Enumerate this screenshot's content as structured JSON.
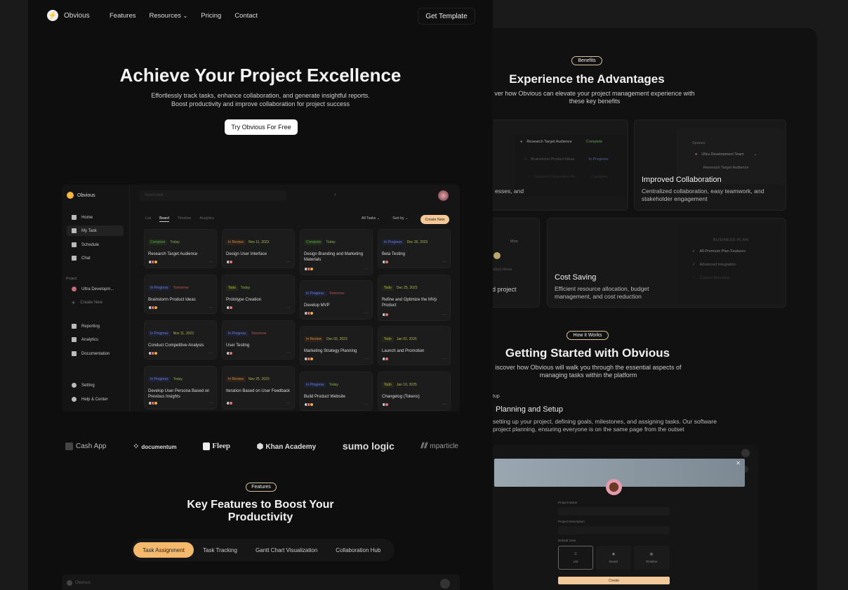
{
  "nav": {
    "brand": "Obvious",
    "links": [
      "Features",
      "Resources",
      "Pricing",
      "Contact"
    ],
    "cta": "Get Template"
  },
  "hero": {
    "title": "Achieve Your Project Excellence",
    "subtitle": "Effortlessly track tasks, enhance collaboration, and generate insightful reports. Boost productivity and improve collaboration for project success",
    "cta": "Try Obvious For Free"
  },
  "app": {
    "brand": "Obvious",
    "search_placeholder": "Search task",
    "search_shortcut": "/",
    "sidebar": {
      "main": [
        "Home",
        "My Task",
        "Schedule",
        "Chat"
      ],
      "section": "Project",
      "project": "Ultra Developm...",
      "create": "Create New",
      "tools": [
        "Reporting",
        "Analytics",
        "Documentation"
      ],
      "bottom": [
        "Setting",
        "Help & Center"
      ]
    },
    "tabs": [
      "List",
      "Board",
      "Timeline",
      "Analytics"
    ],
    "active_tab": "Board",
    "filter": "All Tasks",
    "sort": "Sort by",
    "create_new": "Create New",
    "cards": [
      {
        "status": "Complete",
        "date": "Today",
        "title": "Research Target Audience"
      },
      {
        "status": "In Review",
        "date": "Nov 11, 2023",
        "title": "Design User Interface"
      },
      {
        "status": "Complete",
        "date": "Today",
        "title": "Design Branding and Marketing Materials"
      },
      {
        "status": "In Progress",
        "date": "Dec 20, 2023",
        "title": "Beta Testing"
      },
      {
        "status": "In Progress",
        "date": "Tomorrow",
        "title": "Brainstorm Product Ideas"
      },
      {
        "status": "Todo",
        "date": "Today",
        "title": "Prototype Creation"
      },
      {
        "status": "In Progress",
        "date": "Tomorrow",
        "title": "Develop MVP"
      },
      {
        "status": "Todo",
        "date": "Dec 25, 2023",
        "title": "Refine and Optimize the MVp Product"
      },
      {
        "status": "In Progress",
        "date": "Nov 11, 2023",
        "title": "Conduct Competitive Analysis"
      },
      {
        "status": "In Progress",
        "date": "Tomorrow",
        "title": "User Testing"
      },
      {
        "status": "In Review",
        "date": "Dec 02, 2023",
        "title": "Marketing Strategy Planning"
      },
      {
        "status": "Todo",
        "date": "Jan 02, 2025",
        "title": "Launch and Promotion"
      },
      {
        "status": "In Progress",
        "date": "Today",
        "title": "Develop User Persona Based on Previous Insights"
      },
      {
        "status": "In Review",
        "date": "Nov 25, 2023",
        "title": "Iteration Based on User Feedback"
      },
      {
        "status": "In Progress",
        "date": "Today",
        "title": "Build Product Website"
      },
      {
        "status": "Todo",
        "date": "Jan 10, 2025",
        "title": "Changelog (Tokens)"
      }
    ]
  },
  "logos": [
    "Cash App",
    "documentum",
    "Fleep",
    "Khan Academy",
    "sumo logic",
    "mparticle"
  ],
  "features": {
    "badge": "Features",
    "title_line1": "Key Features to Boost Your",
    "title_line2": "Productivity",
    "tabs": [
      "Task Assignment",
      "Task Tracking",
      "Gantt Chart Visualization",
      "Collaboration Hub"
    ],
    "active_tab": "Task Assignment",
    "preview_brand": "Obvious"
  },
  "benefits": {
    "badge": "Benefits",
    "title": "Experience the Advantages",
    "subtitle_line1": "ver how Obvious can elevate your project management experience with",
    "subtitle_line2": "these key benefits",
    "card1": {
      "desc_fragment": "esses, and",
      "rows": [
        {
          "task": "Research Target Audience",
          "status": "Complete"
        },
        {
          "task": "Brainstorm Product Ideas",
          "status": "In Progress"
        },
        {
          "task": "Conduct Competitive An...",
          "status": "Complete"
        }
      ]
    },
    "card2": {
      "title": "Improved Collaboration",
      "desc": "Centralized collaboration, easy teamwork, and stakeholder engagement",
      "spaces_label": "Spaces",
      "team": "Ultra Development Team",
      "item": "Reserach Target Audience"
    },
    "card3": {
      "desc_fragment": "d project",
      "day": "Mon",
      "item": "roduct Ideas"
    },
    "card4": {
      "title": "Cost Saving",
      "desc": "Efficient resource allocation, budget management, and cost reduction",
      "plan": "BUSINESS PLAN",
      "plan_items": [
        "All Premium Plan Features",
        "Advanced Integration",
        "Custom Branding"
      ]
    }
  },
  "how": {
    "badge": "How it Works",
    "title": "Getting Started with Obvious",
    "subtitle_line1": "iscover how Obvious will walk you through the essential aspects of",
    "subtitle_line2": "managing tasks within the platform",
    "step_label": "tup",
    "step_title": "Planning and Setup",
    "step_desc_line1": "setting up your project, defining goals, milestones, and assigning tasks. Our software",
    "step_desc_line2": "project planning, ensuring everyone is on the same page from the outset",
    "modal": {
      "name_label": "Project Name",
      "desc_label": "Project Description",
      "view_label": "Default View",
      "views": [
        "List",
        "Board",
        "Timeline"
      ],
      "active_view": "List",
      "create": "Create"
    }
  },
  "colors": {
    "accent": "#f5b96e",
    "complete": "#5fa14b",
    "in_review": "#cf8c4b",
    "in_progress": "#6e7fd6",
    "todo": "#b3b84d"
  }
}
